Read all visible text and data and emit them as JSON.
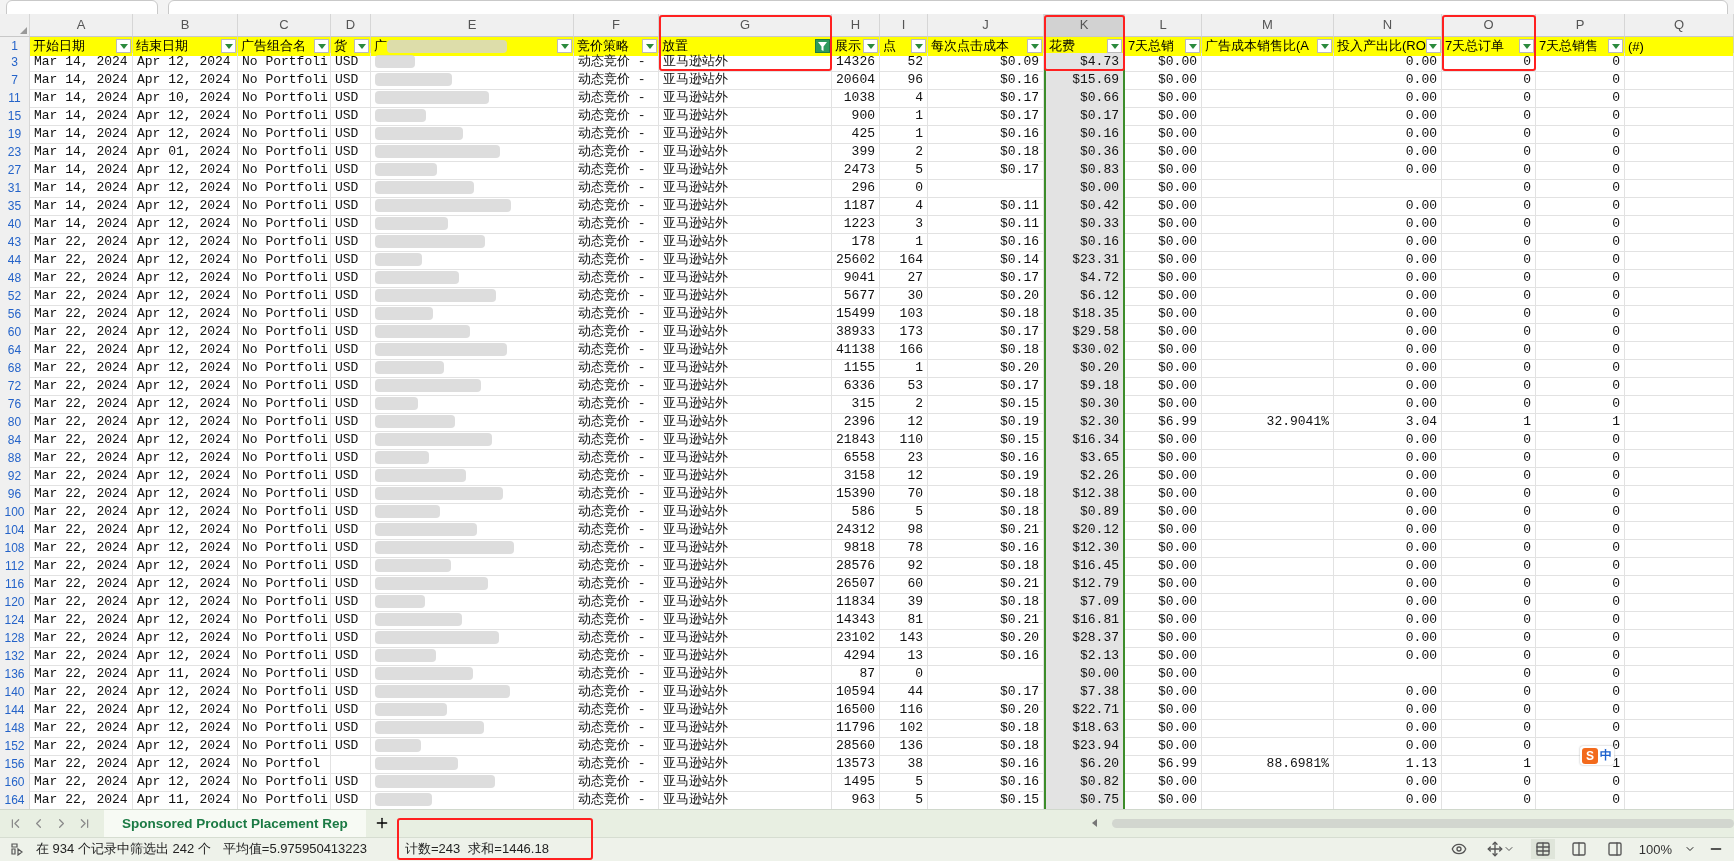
{
  "toolbar": {
    "name_box": {
      "kind": "field"
    },
    "formula_bar": {
      "kind": "field"
    }
  },
  "header_row": "1",
  "columns": [
    {
      "letter": "A",
      "header": "开始日期",
      "kind": "text",
      "selected": false,
      "filtered": false,
      "framed": false
    },
    {
      "letter": "B",
      "header": "结束日期",
      "kind": "text",
      "selected": false,
      "filtered": false,
      "framed": false
    },
    {
      "letter": "C",
      "header": "广告组合名",
      "kind": "text",
      "selected": false,
      "filtered": false,
      "framed": false
    },
    {
      "letter": "D",
      "header": "货",
      "kind": "text",
      "selected": false,
      "filtered": false,
      "framed": false
    },
    {
      "letter": "E",
      "header": "广",
      "kind": "blurred",
      "selected": false,
      "filtered": false,
      "framed": false
    },
    {
      "letter": "F",
      "header": "竞价策略",
      "kind": "text",
      "selected": false,
      "filtered": false,
      "framed": false
    },
    {
      "letter": "G",
      "header": "放置",
      "kind": "text",
      "selected": false,
      "filtered": true,
      "framed": true
    },
    {
      "letter": "H",
      "header": "展示",
      "kind": "number",
      "selected": false,
      "filtered": false,
      "framed": false
    },
    {
      "letter": "I",
      "header": "点",
      "kind": "number",
      "selected": false,
      "filtered": false,
      "framed": false
    },
    {
      "letter": "J",
      "header": "每次点击成本",
      "kind": "number",
      "selected": false,
      "filtered": false,
      "framed": false
    },
    {
      "letter": "K",
      "header": "花费",
      "kind": "number",
      "selected": true,
      "filtered": false,
      "framed": true
    },
    {
      "letter": "L",
      "header": "7天总销",
      "kind": "number",
      "selected": false,
      "filtered": false,
      "framed": false
    },
    {
      "letter": "M",
      "header": "广告成本销售比(A",
      "kind": "number",
      "selected": false,
      "filtered": false,
      "framed": false
    },
    {
      "letter": "N",
      "header": "投入产出比(RO",
      "kind": "number",
      "selected": false,
      "filtered": false,
      "framed": false
    },
    {
      "letter": "O",
      "header": "7天总订单",
      "kind": "number",
      "selected": false,
      "filtered": false,
      "framed": true
    },
    {
      "letter": "P",
      "header": "7天总销售",
      "kind": "number",
      "selected": false,
      "filtered": false,
      "framed": false
    },
    {
      "letter": "Q",
      "header": "(#)",
      "kind": "spill",
      "selected": false,
      "framed": false
    }
  ],
  "rows": [
    {
      "row": "3",
      "cells": [
        "Mar 14, 2024",
        "Apr 12, 2024",
        "No Portfoli",
        "USD",
        "动态竞价 -",
        "亚马逊站外",
        "14326",
        "52",
        "$0.09",
        "$4.73",
        "$0.00",
        null,
        "0.00",
        "0",
        "0"
      ]
    },
    {
      "row": "7",
      "cells": [
        "Mar 14, 2024",
        "Apr 12, 2024",
        "No Portfoli",
        "USD",
        "动态竞价 -",
        "亚马逊站外",
        "20604",
        "96",
        "$0.16",
        "$15.69",
        "$0.00",
        null,
        "0.00",
        "0",
        "0"
      ]
    },
    {
      "row": "11",
      "cells": [
        "Mar 14, 2024",
        "Apr 10, 2024",
        "No Portfoli",
        "USD",
        "动态竞价 -",
        "亚马逊站外",
        "1038",
        "4",
        "$0.17",
        "$0.66",
        "$0.00",
        null,
        "0.00",
        "0",
        "0"
      ]
    },
    {
      "row": "15",
      "cells": [
        "Mar 14, 2024",
        "Apr 12, 2024",
        "No Portfoli",
        "USD",
        "动态竞价 -",
        "亚马逊站外",
        "900",
        "1",
        "$0.17",
        "$0.17",
        "$0.00",
        null,
        "0.00",
        "0",
        "0"
      ]
    },
    {
      "row": "19",
      "cells": [
        "Mar 14, 2024",
        "Apr 12, 2024",
        "No Portfoli",
        "USD",
        "动态竞价 -",
        "亚马逊站外",
        "425",
        "1",
        "$0.16",
        "$0.16",
        "$0.00",
        null,
        "0.00",
        "0",
        "0"
      ]
    },
    {
      "row": "23",
      "cells": [
        "Mar 14, 2024",
        "Apr 01, 2024",
        "No Portfoli",
        "USD",
        "动态竞价 -",
        "亚马逊站外",
        "399",
        "2",
        "$0.18",
        "$0.36",
        "$0.00",
        null,
        "0.00",
        "0",
        "0"
      ]
    },
    {
      "row": "27",
      "cells": [
        "Mar 14, 2024",
        "Apr 12, 2024",
        "No Portfoli",
        "USD",
        "动态竞价 -",
        "亚马逊站外",
        "2473",
        "5",
        "$0.17",
        "$0.83",
        "$0.00",
        null,
        "0.00",
        "0",
        "0"
      ]
    },
    {
      "row": "31",
      "cells": [
        "Mar 14, 2024",
        "Apr 12, 2024",
        "No Portfoli",
        "USD",
        "动态竞价 -",
        "亚马逊站外",
        "296",
        "0",
        null,
        "$0.00",
        "$0.00",
        null,
        null,
        "0",
        "0"
      ]
    },
    {
      "row": "35",
      "cells": [
        "Mar 14, 2024",
        "Apr 12, 2024",
        "No Portfoli",
        "USD",
        "动态竞价 -",
        "亚马逊站外",
        "1187",
        "4",
        "$0.11",
        "$0.42",
        "$0.00",
        null,
        "0.00",
        "0",
        "0"
      ]
    },
    {
      "row": "40",
      "cells": [
        "Mar 14, 2024",
        "Apr 12, 2024",
        "No Portfoli",
        "USD",
        "动态竞价 -",
        "亚马逊站外",
        "1223",
        "3",
        "$0.11",
        "$0.33",
        "$0.00",
        null,
        "0.00",
        "0",
        "0"
      ]
    },
    {
      "row": "43",
      "cells": [
        "Mar 22, 2024",
        "Apr 12, 2024",
        "No Portfoli",
        "USD",
        "动态竞价 -",
        "亚马逊站外",
        "178",
        "1",
        "$0.16",
        "$0.16",
        "$0.00",
        null,
        "0.00",
        "0",
        "0"
      ]
    },
    {
      "row": "44",
      "cells": [
        "Mar 22, 2024",
        "Apr 12, 2024",
        "No Portfoli",
        "USD",
        "动态竞价 -",
        "亚马逊站外",
        "25602",
        "164",
        "$0.14",
        "$23.31",
        "$0.00",
        null,
        "0.00",
        "0",
        "0"
      ]
    },
    {
      "row": "48",
      "cells": [
        "Mar 22, 2024",
        "Apr 12, 2024",
        "No Portfoli",
        "USD",
        "动态竞价 -",
        "亚马逊站外",
        "9041",
        "27",
        "$0.17",
        "$4.72",
        "$0.00",
        null,
        "0.00",
        "0",
        "0"
      ]
    },
    {
      "row": "52",
      "cells": [
        "Mar 22, 2024",
        "Apr 12, 2024",
        "No Portfoli",
        "USD",
        "动态竞价 -",
        "亚马逊站外",
        "5677",
        "30",
        "$0.20",
        "$6.12",
        "$0.00",
        null,
        "0.00",
        "0",
        "0"
      ]
    },
    {
      "row": "56",
      "cells": [
        "Mar 22, 2024",
        "Apr 12, 2024",
        "No Portfoli",
        "USD",
        "动态竞价 -",
        "亚马逊站外",
        "15499",
        "103",
        "$0.18",
        "$18.35",
        "$0.00",
        null,
        "0.00",
        "0",
        "0"
      ]
    },
    {
      "row": "60",
      "cells": [
        "Mar 22, 2024",
        "Apr 12, 2024",
        "No Portfoli",
        "USD",
        "动态竞价 -",
        "亚马逊站外",
        "38933",
        "173",
        "$0.17",
        "$29.58",
        "$0.00",
        null,
        "0.00",
        "0",
        "0"
      ]
    },
    {
      "row": "64",
      "cells": [
        "Mar 22, 2024",
        "Apr 12, 2024",
        "No Portfoli",
        "USD",
        "动态竞价 -",
        "亚马逊站外",
        "41138",
        "166",
        "$0.18",
        "$30.02",
        "$0.00",
        null,
        "0.00",
        "0",
        "0"
      ]
    },
    {
      "row": "68",
      "cells": [
        "Mar 22, 2024",
        "Apr 12, 2024",
        "No Portfoli",
        "USD",
        "动态竞价 -",
        "亚马逊站外",
        "1155",
        "1",
        "$0.20",
        "$0.20",
        "$0.00",
        null,
        "0.00",
        "0",
        "0"
      ]
    },
    {
      "row": "72",
      "cells": [
        "Mar 22, 2024",
        "Apr 12, 2024",
        "No Portfoli",
        "USD",
        "动态竞价 -",
        "亚马逊站外",
        "6336",
        "53",
        "$0.17",
        "$9.18",
        "$0.00",
        null,
        "0.00",
        "0",
        "0"
      ]
    },
    {
      "row": "76",
      "cells": [
        "Mar 22, 2024",
        "Apr 12, 2024",
        "No Portfoli",
        "USD",
        "动态竞价 -",
        "亚马逊站外",
        "315",
        "2",
        "$0.15",
        "$0.30",
        "$0.00",
        null,
        "0.00",
        "0",
        "0"
      ]
    },
    {
      "row": "80",
      "cells": [
        "Mar 22, 2024",
        "Apr 12, 2024",
        "No Portfoli",
        "USD",
        "动态竞价 -",
        "亚马逊站外",
        "2396",
        "12",
        "$0.19",
        "$2.30",
        "$6.99",
        "32.9041%",
        "3.04",
        "1",
        "1"
      ]
    },
    {
      "row": "84",
      "cells": [
        "Mar 22, 2024",
        "Apr 12, 2024",
        "No Portfoli",
        "USD",
        "动态竞价 -",
        "亚马逊站外",
        "21843",
        "110",
        "$0.15",
        "$16.34",
        "$0.00",
        null,
        "0.00",
        "0",
        "0"
      ]
    },
    {
      "row": "88",
      "cells": [
        "Mar 22, 2024",
        "Apr 12, 2024",
        "No Portfoli",
        "USD",
        "动态竞价 -",
        "亚马逊站外",
        "6558",
        "23",
        "$0.16",
        "$3.65",
        "$0.00",
        null,
        "0.00",
        "0",
        "0"
      ]
    },
    {
      "row": "92",
      "cells": [
        "Mar 22, 2024",
        "Apr 12, 2024",
        "No Portfoli",
        "USD",
        "动态竞价 -",
        "亚马逊站外",
        "3158",
        "12",
        "$0.19",
        "$2.26",
        "$0.00",
        null,
        "0.00",
        "0",
        "0"
      ]
    },
    {
      "row": "96",
      "cells": [
        "Mar 22, 2024",
        "Apr 12, 2024",
        "No Portfoli",
        "USD",
        "动态竞价 -",
        "亚马逊站外",
        "15390",
        "70",
        "$0.18",
        "$12.38",
        "$0.00",
        null,
        "0.00",
        "0",
        "0"
      ]
    },
    {
      "row": "100",
      "cells": [
        "Mar 22, 2024",
        "Apr 12, 2024",
        "No Portfoli",
        "USD",
        "动态竞价 -",
        "亚马逊站外",
        "586",
        "5",
        "$0.18",
        "$0.89",
        "$0.00",
        null,
        "0.00",
        "0",
        "0"
      ]
    },
    {
      "row": "104",
      "cells": [
        "Mar 22, 2024",
        "Apr 12, 2024",
        "No Portfoli",
        "USD",
        "动态竞价 -",
        "亚马逊站外",
        "24312",
        "98",
        "$0.21",
        "$20.12",
        "$0.00",
        null,
        "0.00",
        "0",
        "0"
      ]
    },
    {
      "row": "108",
      "cells": [
        "Mar 22, 2024",
        "Apr 12, 2024",
        "No Portfoli",
        "USD",
        "动态竞价 -",
        "亚马逊站外",
        "9818",
        "78",
        "$0.16",
        "$12.30",
        "$0.00",
        null,
        "0.00",
        "0",
        "0"
      ]
    },
    {
      "row": "112",
      "cells": [
        "Mar 22, 2024",
        "Apr 12, 2024",
        "No Portfoli",
        "USD",
        "动态竞价 -",
        "亚马逊站外",
        "28576",
        "92",
        "$0.18",
        "$16.45",
        "$0.00",
        null,
        "0.00",
        "0",
        "0"
      ]
    },
    {
      "row": "116",
      "cells": [
        "Mar 22, 2024",
        "Apr 12, 2024",
        "No Portfoli",
        "USD",
        "动态竞价 -",
        "亚马逊站外",
        "26507",
        "60",
        "$0.21",
        "$12.79",
        "$0.00",
        null,
        "0.00",
        "0",
        "0"
      ]
    },
    {
      "row": "120",
      "cells": [
        "Mar 22, 2024",
        "Apr 12, 2024",
        "No Portfoli",
        "USD",
        "动态竞价 -",
        "亚马逊站外",
        "11834",
        "39",
        "$0.18",
        "$7.09",
        "$0.00",
        null,
        "0.00",
        "0",
        "0"
      ]
    },
    {
      "row": "124",
      "cells": [
        "Mar 22, 2024",
        "Apr 12, 2024",
        "No Portfoli",
        "USD",
        "动态竞价 -",
        "亚马逊站外",
        "14343",
        "81",
        "$0.21",
        "$16.81",
        "$0.00",
        null,
        "0.00",
        "0",
        "0"
      ]
    },
    {
      "row": "128",
      "cells": [
        "Mar 22, 2024",
        "Apr 12, 2024",
        "No Portfoli",
        "USD",
        "动态竞价 -",
        "亚马逊站外",
        "23102",
        "143",
        "$0.20",
        "$28.37",
        "$0.00",
        null,
        "0.00",
        "0",
        "0"
      ]
    },
    {
      "row": "132",
      "cells": [
        "Mar 22, 2024",
        "Apr 12, 2024",
        "No Portfoli",
        "USD",
        "动态竞价 -",
        "亚马逊站外",
        "4294",
        "13",
        "$0.16",
        "$2.13",
        "$0.00",
        null,
        "0.00",
        "0",
        "0"
      ]
    },
    {
      "row": "136",
      "cells": [
        "Mar 22, 2024",
        "Apr 11, 2024",
        "No Portfoli",
        "USD",
        "动态竞价 -",
        "亚马逊站外",
        "87",
        "0",
        null,
        "$0.00",
        "$0.00",
        null,
        null,
        "0",
        "0"
      ]
    },
    {
      "row": "140",
      "cells": [
        "Mar 22, 2024",
        "Apr 12, 2024",
        "No Portfoli",
        "USD",
        "动态竞价 -",
        "亚马逊站外",
        "10594",
        "44",
        "$0.17",
        "$7.38",
        "$0.00",
        null,
        "0.00",
        "0",
        "0"
      ]
    },
    {
      "row": "144",
      "cells": [
        "Mar 22, 2024",
        "Apr 12, 2024",
        "No Portfoli",
        "USD",
        "动态竞价 -",
        "亚马逊站外",
        "16500",
        "116",
        "$0.20",
        "$22.71",
        "$0.00",
        null,
        "0.00",
        "0",
        "0"
      ]
    },
    {
      "row": "148",
      "cells": [
        "Mar 22, 2024",
        "Apr 12, 2024",
        "No Portfoli",
        "USD",
        "动态竞价 -",
        "亚马逊站外",
        "11796",
        "102",
        "$0.18",
        "$18.63",
        "$0.00",
        null,
        "0.00",
        "0",
        "0"
      ]
    },
    {
      "row": "152",
      "cells": [
        "Mar 22, 2024",
        "Apr 12, 2024",
        "No Portfoli",
        "USD",
        "动态竞价 -",
        "亚马逊站外",
        "28560",
        "136",
        "$0.18",
        "$23.94",
        "$0.00",
        null,
        "0.00",
        "0",
        "0"
      ]
    },
    {
      "row": "156",
      "cells": [
        "Mar 22, 2024",
        "Apr 12, 2024",
        "No Portfol",
        null,
        "动态竞价 -",
        "亚马逊站外",
        "13573",
        "38",
        "$0.16",
        "$6.20",
        "$6.99",
        "88.6981%",
        "1.13",
        "1",
        "1"
      ]
    },
    {
      "row": "160",
      "cells": [
        "Mar 22, 2024",
        "Apr 12, 2024",
        "No Portfoli",
        "USD",
        "动态竞价 -",
        "亚马逊站外",
        "1495",
        "5",
        "$0.16",
        "$0.82",
        "$0.00",
        null,
        "0.00",
        "0",
        "0"
      ]
    },
    {
      "row": "164",
      "cells": [
        "Mar 22, 2024",
        "Apr 11, 2024",
        "No Portfoli",
        "USD",
        "动态竞价 -",
        "亚马逊站外",
        "963",
        "5",
        "$0.15",
        "$0.75",
        "$0.00",
        null,
        "0.00",
        "0",
        "0"
      ]
    }
  ],
  "sheet_tabs": [
    {
      "label": "Sponsored Product Placement Rep",
      "selected": true
    }
  ],
  "ime": {
    "logo": "S",
    "mode": "中"
  },
  "status_bar": {
    "filter_summary": "在 934 个记录中筛选出 242 个",
    "average": "平均值=5.975950413223",
    "count": "计数=243",
    "sum": "求和=1446.18",
    "framed": true,
    "zoom": "100%"
  }
}
